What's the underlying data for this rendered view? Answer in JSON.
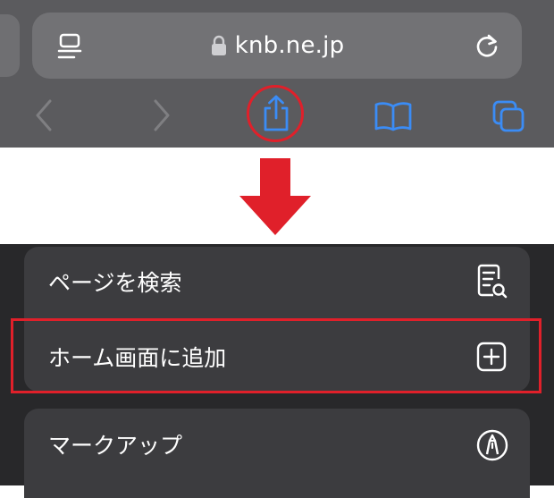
{
  "browser": {
    "url": "knb.ne.jp"
  },
  "share_menu": {
    "items": [
      {
        "label": "ページを検索",
        "icon": "find-on-page-icon"
      },
      {
        "label": "ホーム画面に追加",
        "icon": "add-square-icon"
      },
      {
        "label": "マークアップ",
        "icon": "markup-pen-icon"
      }
    ]
  },
  "colors": {
    "toolbar_bg": "#5b5b5e",
    "url_field_bg": "#727275",
    "accent_blue": "#3b8cf5",
    "annotation_red": "#e0202a",
    "sheet_bg": "#28282a",
    "group_bg": "#3c3c3f"
  }
}
